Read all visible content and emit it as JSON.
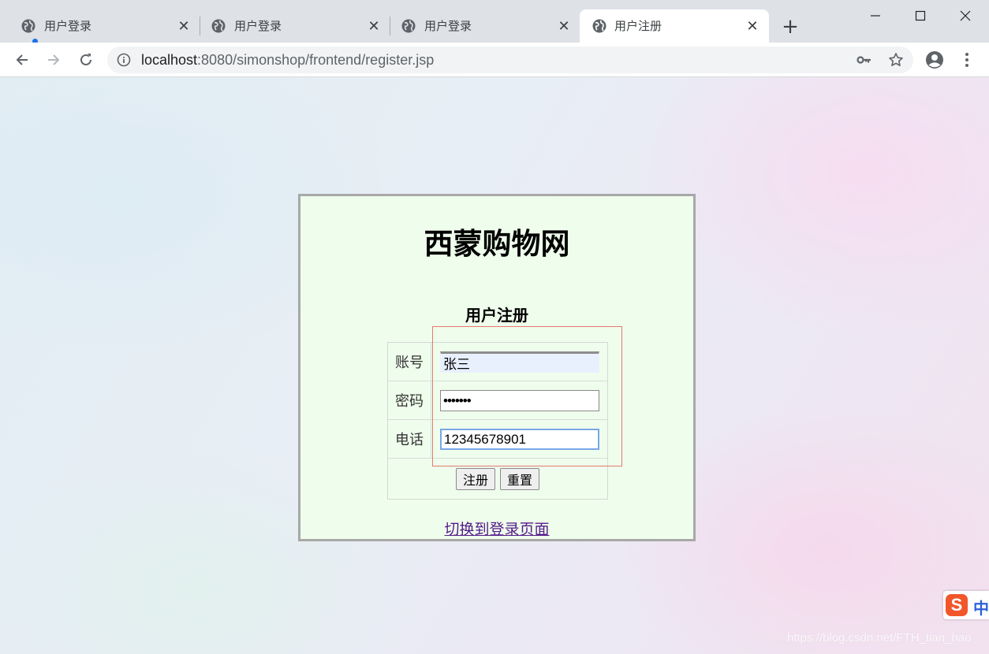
{
  "browser": {
    "tabs": [
      {
        "title": "用户登录",
        "active": false,
        "close": "✕"
      },
      {
        "title": "用户登录",
        "active": false,
        "close": "✕"
      },
      {
        "title": "用户登录",
        "active": false,
        "close": "✕"
      },
      {
        "title": "用户注册",
        "active": true,
        "close": "✕"
      }
    ],
    "new_tab": "+",
    "url_host": "localhost",
    "url_rest": ":8080/simonshop/frontend/register.jsp"
  },
  "page": {
    "site_title": "西蒙购物网",
    "form_title": "用户注册",
    "fields": [
      {
        "label": "账号",
        "value": "张三",
        "type": "text"
      },
      {
        "label": "密码",
        "value": "•••••••",
        "type": "password"
      },
      {
        "label": "电话",
        "value": "12345678901",
        "type": "text"
      }
    ],
    "submit_label": "注册",
    "reset_label": "重置",
    "switch_link": "切换到登录页面"
  },
  "ime": {
    "logo": "S",
    "mode": "中"
  },
  "watermark": "https://blog.csdn.net/FTH_tian_hao",
  "colors": {
    "tab_strip": "#dee1e6",
    "panel_bg": "#effeec",
    "panel_border": "#a8a8a8",
    "link_visited": "#551a8b",
    "highlight_box": "#e8796f",
    "ime_logo": "#f2562b"
  }
}
